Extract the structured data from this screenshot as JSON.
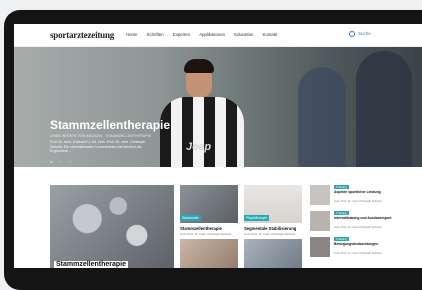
{
  "site": {
    "logo": "sportarztezeitung"
  },
  "nav": {
    "items": [
      "Home",
      "Schriften",
      "Experten",
      "Applikationen",
      "Education",
      "Kontakt"
    ],
    "search_label": "Suche"
  },
  "hero": {
    "title": "Stammzellentherapie",
    "meta": "Links Wissen von Medizin - Stammzellentherapie",
    "text": "Prof. Dr. med. Eckhard U. Alt, Univ. Prof. Dr. med. Christoph Schmitz Ein internationales Forscherteam hat kürzlich die Ergebnisse...",
    "jersey_text": "Jeep"
  },
  "cards": [
    {
      "badge": "Stammzelle",
      "title": "Stammzellentherapie",
      "meta": "Univ.-Prof. Dr. med. Christoph Schmitz"
    },
    {
      "badge": "Physiotherapie",
      "title": "Segmentale Stabilisierung",
      "meta": "Univ.-Prof. Dr. med. Christoph Schmitz"
    }
  ],
  "big_card": {
    "title": "Stammzellentherapie"
  },
  "side": [
    {
      "badge": "Training",
      "title": "Aspekte sportlicher Leistung",
      "meta": "Univ.-Prof. Dr. med. Christoph Schmitz"
    },
    {
      "badge": "Training",
      "title": "Intervalltraining und Ausdauersport",
      "meta": "Univ.-Prof. Dr. med. Christoph Schmitz"
    },
    {
      "badge": "Training",
      "title": "Bewegungsbeobachtungen",
      "meta": "Univ.-Prof. Dr. med. Christoph Schmitz"
    }
  ],
  "colors": {
    "accent": "#2aa7b5",
    "link": "#3a7bd5",
    "frame": "#141414"
  }
}
